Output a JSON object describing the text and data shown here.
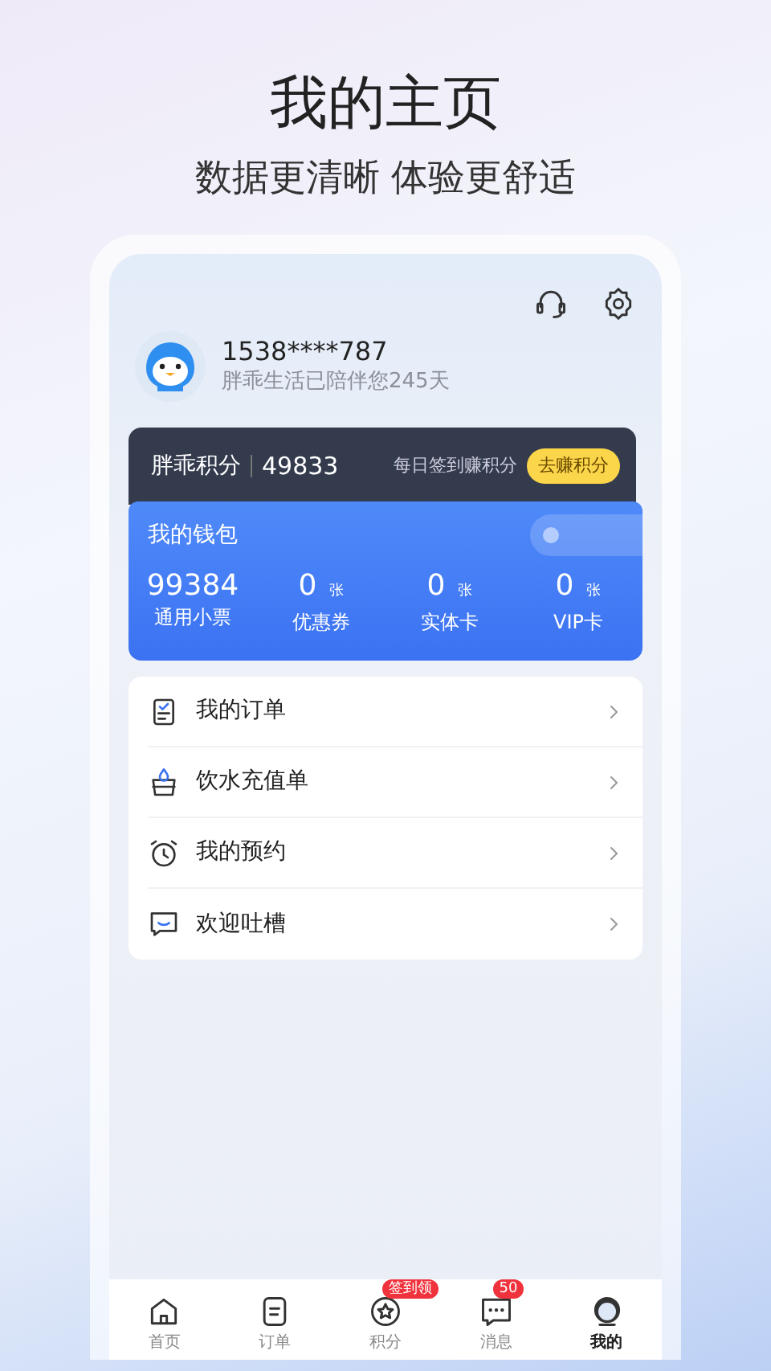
{
  "headline": {
    "title": "我的主页",
    "subtitle": "数据更清晰 体验更舒适"
  },
  "profile": {
    "phone": "1538****787",
    "subtitle": "胖乖生活已陪伴您245天"
  },
  "points": {
    "label": "胖乖积分",
    "value": "49833",
    "hint": "每日签到赚积分",
    "button": "去赚积分"
  },
  "wallet": {
    "title": "我的钱包",
    "switch_on": false,
    "stats": [
      {
        "value": "99384",
        "label": "通用小票"
      },
      {
        "value": "0",
        "unit": "张",
        "label": "优惠券"
      },
      {
        "value": "0",
        "unit": "张",
        "label": "实体卡"
      },
      {
        "value": "0",
        "unit": "张",
        "label": "VIP卡"
      }
    ]
  },
  "menu": [
    {
      "kind": "order",
      "label": "我的订单"
    },
    {
      "kind": "water",
      "label": "饮水充值单"
    },
    {
      "kind": "alarm",
      "label": "我的预约"
    },
    {
      "kind": "chat",
      "label": "欢迎吐槽"
    }
  ],
  "tabs": [
    {
      "kind": "home",
      "label": "首页",
      "selected": false
    },
    {
      "kind": "order",
      "label": "订单",
      "selected": false
    },
    {
      "kind": "points",
      "label": "积分",
      "selected": false,
      "badge": "签到领"
    },
    {
      "kind": "message",
      "label": "消息",
      "selected": false,
      "badge": "50"
    },
    {
      "kind": "mine",
      "label": "我的",
      "selected": true
    }
  ]
}
